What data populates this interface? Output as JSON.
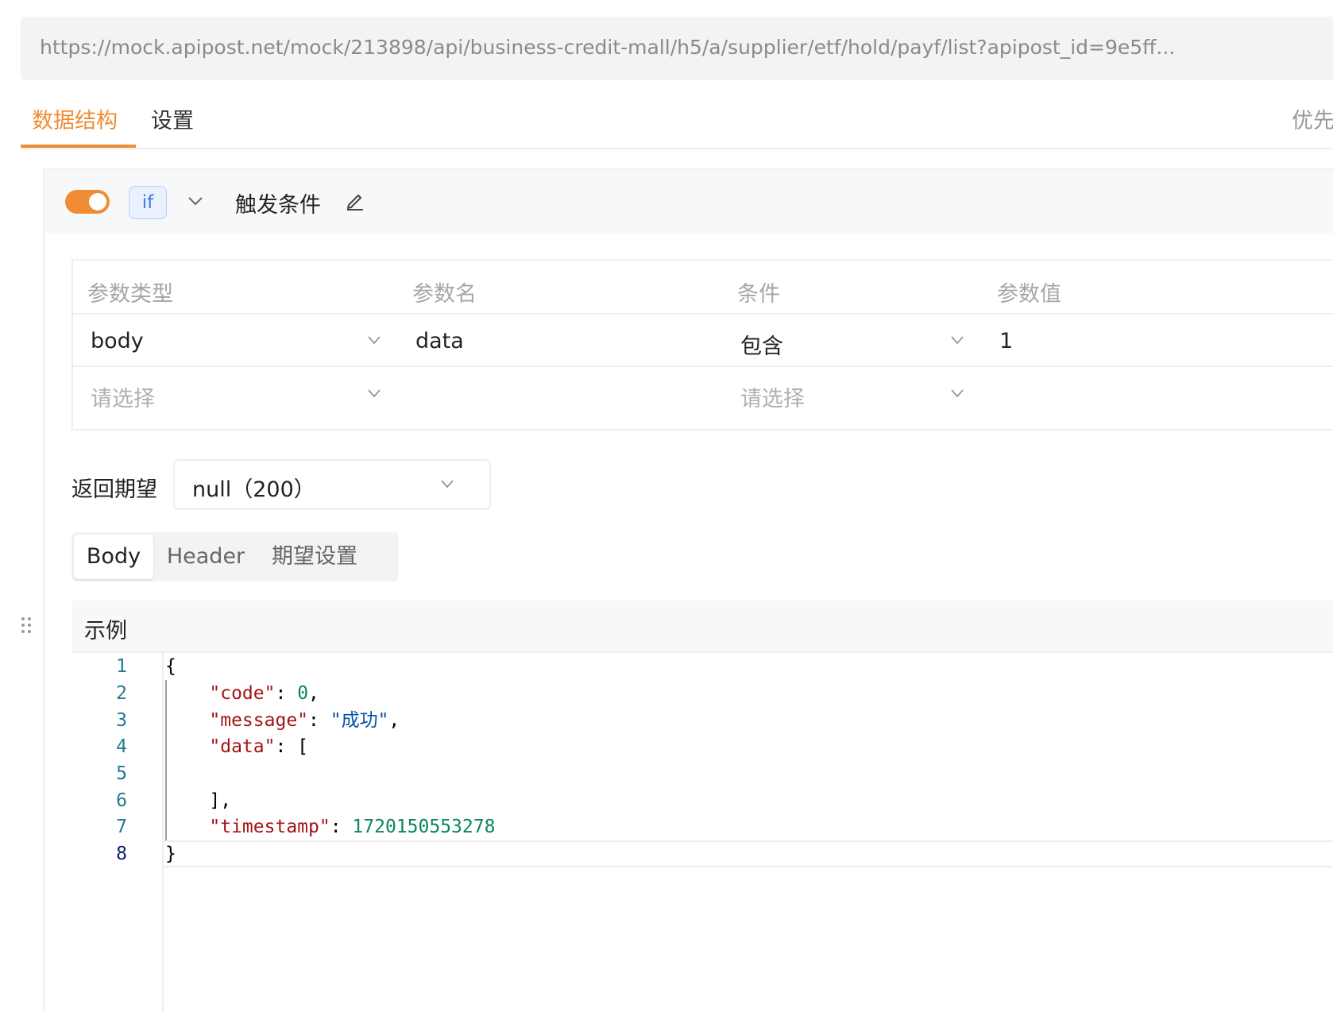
{
  "url": "https://mock.apipost.net/mock/213898/api/business-credit-mall/h5/a/supplier/etf/hold/payf/list?apipost_id=9e5ff...",
  "tabs": [
    {
      "label": "数据结构",
      "active": true
    },
    {
      "label": "设置",
      "active": false
    }
  ],
  "priority_label": "优先",
  "rule": {
    "enabled": true,
    "badge": "if",
    "title": "触发条件"
  },
  "conditions": {
    "headers": [
      "参数类型",
      "参数名",
      "条件",
      "参数值"
    ],
    "rows": [
      {
        "type": "body",
        "name": "data",
        "condition": "包含",
        "value": "1"
      },
      {
        "type_placeholder": "请选择",
        "condition_placeholder": "请选择"
      }
    ]
  },
  "return_expectation": {
    "label": "返回期望",
    "value": "null（200）"
  },
  "response_tabs": [
    {
      "label": "Body",
      "active": true
    },
    {
      "label": "Header",
      "active": false
    },
    {
      "label": "期望设置",
      "active": false
    }
  ],
  "example": {
    "title": "示例",
    "line_numbers": [
      "1",
      "2",
      "3",
      "4",
      "5",
      "6",
      "7",
      "8"
    ],
    "current_line": 8,
    "code": {
      "open_brace": "{",
      "code_key": "\"code\"",
      "code_value": "0",
      "message_key": "\"message\"",
      "message_value": "\"成功\"",
      "data_key": "\"data\"",
      "data_open": "[",
      "data_close": "],",
      "timestamp_key": "\"timestamp\"",
      "timestamp_value": "1720150553278",
      "close_brace": "}"
    }
  },
  "colors": {
    "accent": "#f08c34",
    "badge_blue": "#3d7cf0",
    "json_key": "#a31515",
    "json_number": "#098658",
    "json_string": "#0451a5"
  },
  "icons": {
    "rule_dropdown": "chevron-down-icon",
    "rule_edit": "pencil-icon",
    "drag": "drag-handle-icon"
  }
}
